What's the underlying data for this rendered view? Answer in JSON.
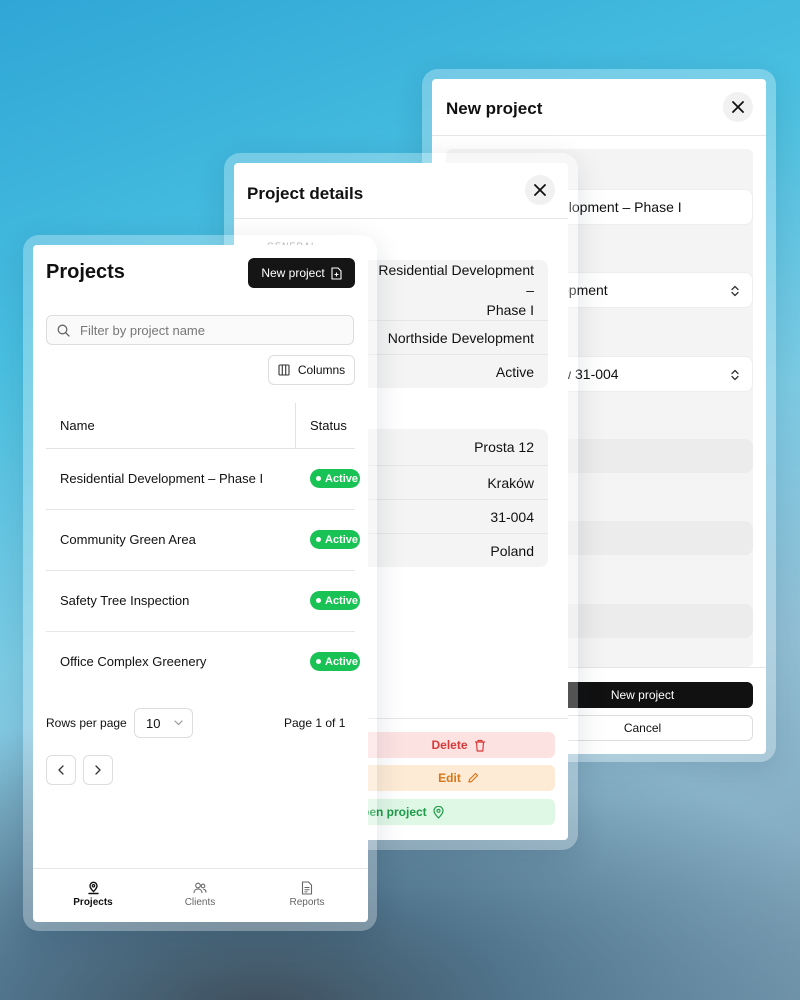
{
  "new_project_panel": {
    "title": "New project",
    "field_project_name": "elopment – Phase I",
    "field_client": "opment",
    "field_address": "w 31-004",
    "submit_label": "New project",
    "cancel_label": "Cancel"
  },
  "project_details_panel": {
    "title": "Project details",
    "section_general": "GENERAL",
    "general": {
      "name_line1": "Residential Development –",
      "name_line2": "Phase I",
      "client": "Northside Development",
      "status": "Active"
    },
    "address": {
      "street": "Prosta 12",
      "city": "Kraków",
      "postal_code": "31-004",
      "country": "Poland"
    },
    "delete_label": "Delete",
    "edit_label": "Edit",
    "open_label": "pen project"
  },
  "projects_panel": {
    "title": "Projects",
    "new_project_label": "New project",
    "filter_placeholder": "Filter by project name",
    "columns_label": "Columns",
    "columns": [
      "Name",
      "Status"
    ],
    "rows": [
      {
        "name": "Residential Development – Phase I",
        "status": "Active"
      },
      {
        "name": "Community Green Area",
        "status": "Active"
      },
      {
        "name": "Safety Tree Inspection",
        "status": "Active"
      },
      {
        "name": "Office Complex Greenery",
        "status": "Active"
      }
    ],
    "rows_per_page_label": "Rows per page",
    "rows_per_page_value": "10",
    "page_info": "Page 1 of 1",
    "nav": {
      "projects": "Projects",
      "clients": "Clients",
      "reports": "Reports"
    }
  },
  "colors": {
    "active_badge": "#19c254",
    "primary_button": "#151515",
    "delete_bg": "#fde2e2",
    "delete_text": "#d83a3a",
    "edit_bg": "#fdebd6",
    "edit_text": "#d9761a",
    "open_bg": "#dff7e5",
    "open_text": "#1c9b48"
  },
  "icons": {
    "close": "close-icon",
    "new_project": "file-plus-icon",
    "search": "search-icon",
    "columns": "columns-icon",
    "trash": "trash-icon",
    "pencil": "pencil-icon",
    "map_pin": "map-pin-icon",
    "chevron_up_down": "chevron-up-down-icon",
    "chevron_down": "chevron-down-icon",
    "chevron_left": "chevron-left-icon",
    "chevron_right": "chevron-right-icon",
    "nav_projects": "map-pin-icon",
    "nav_clients": "users-icon",
    "nav_reports": "file-text-icon"
  }
}
